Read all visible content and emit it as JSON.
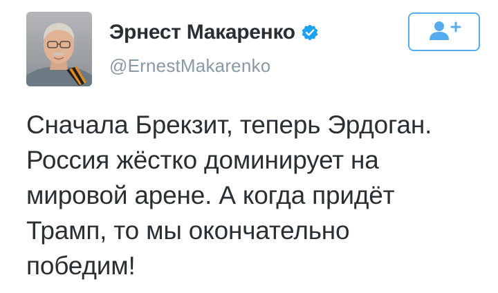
{
  "author": {
    "display_name": "Эрнест Макаренко",
    "username": "@ErnestMakarenko",
    "verified": true
  },
  "follow_button": {
    "icon": "follow-user-icon",
    "accent_color": "#55acee"
  },
  "tweet": {
    "text": "Сначала Брекзит, теперь Эрдоган.\nРоссия жёстко доминирует на\nмировой арене. А когда придёт\nТрамп, то мы окончательно\nпобедим!"
  },
  "colors": {
    "text": "#292f33",
    "muted": "#8899a6",
    "verified_badge": "#1da1f2"
  }
}
